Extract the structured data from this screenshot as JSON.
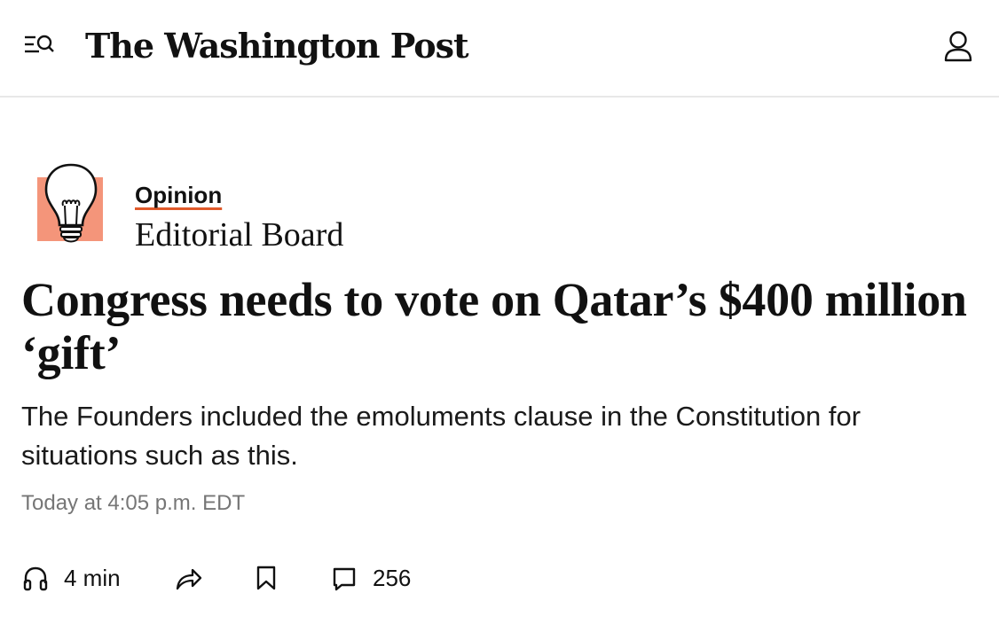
{
  "header": {
    "logo_text": "The Washington Post",
    "menu_icon": "menu-search-icon",
    "account_icon": "user-icon"
  },
  "byline": {
    "section": "Opinion",
    "author": "Editorial Board",
    "illustration": "lightbulb-icon",
    "illustration_color": "#f4957a",
    "underline_color": "#e05a2b"
  },
  "article": {
    "headline": "Congress needs to vote on Qatar’s $400 million ‘gift’",
    "dek": "The Founders included the emoluments clause in the Constitution for situations such as this.",
    "timestamp": "Today at 4:05 p.m. EDT"
  },
  "actions": {
    "listen_label": "4 min",
    "listen_icon": "headphones-icon",
    "share_icon": "share-icon",
    "save_icon": "bookmark-icon",
    "comments_icon": "comment-icon",
    "comments_count": "256"
  }
}
